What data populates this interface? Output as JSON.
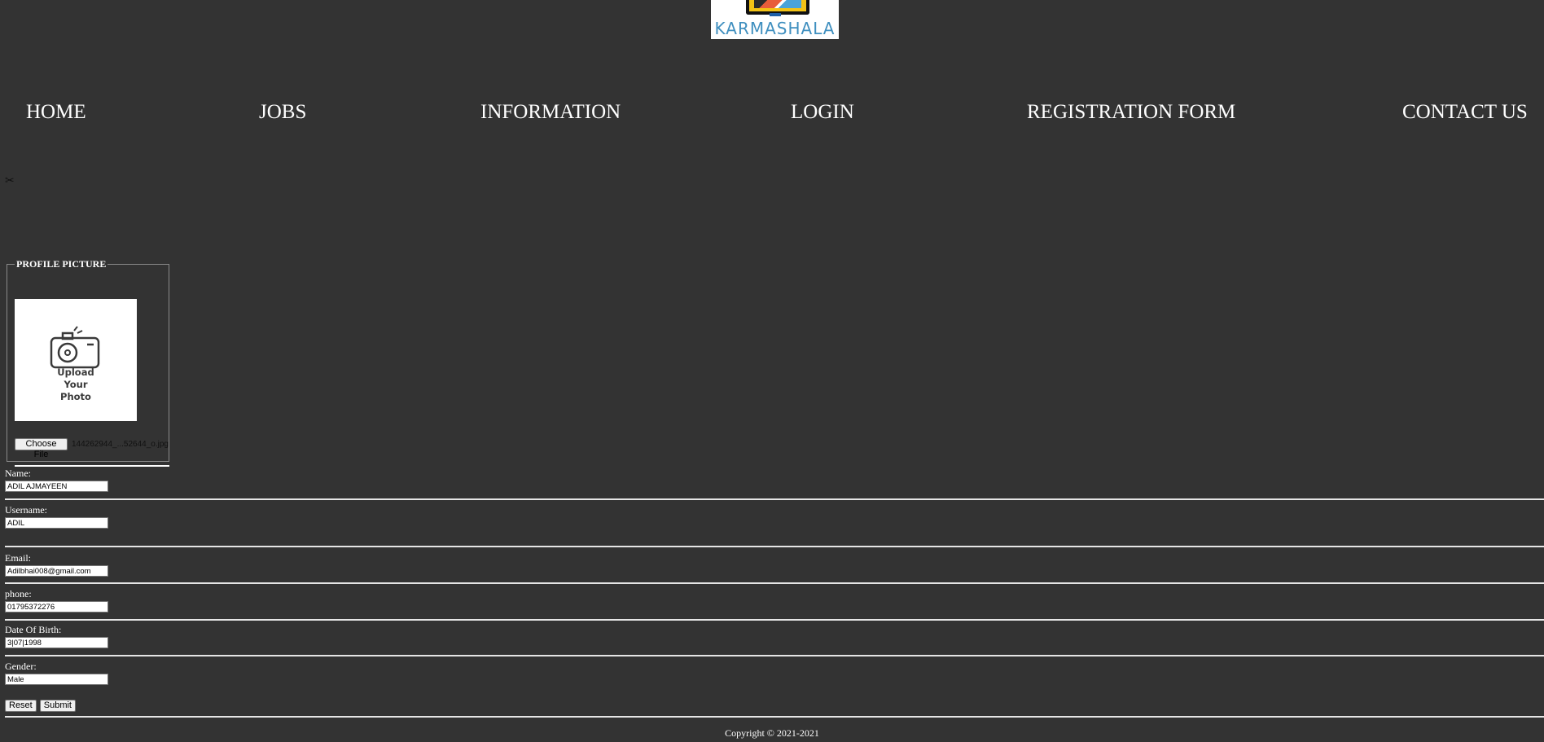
{
  "logo": {
    "wordmark": "KARMASHALA"
  },
  "nav": {
    "items": [
      "HOME",
      "JOBS",
      "INFORMATION",
      "LOGIN",
      "REGISTRATION FORM",
      "CONTACT US"
    ]
  },
  "broken_image_icon": "broken-image-icon",
  "profile": {
    "legend": "PROFILE PICTURE",
    "upload_text": "Upload\nYour\nPhoto",
    "choose_file_label": "Choose File",
    "file_name": "144262944_...52644_o.jpg"
  },
  "form": {
    "name": {
      "label": "Name:",
      "value": "ADIL AJMAYEEN"
    },
    "username": {
      "label": "Username:",
      "value": "ADIL"
    },
    "email": {
      "label": "Email:",
      "value": "Adilbhai008@gmail.com"
    },
    "phone": {
      "label": "phone:",
      "value": "01795372276"
    },
    "dob": {
      "label": "Date Of Birth:",
      "value": "3|07|1998"
    },
    "gender": {
      "label": "Gender:",
      "value": "Male"
    },
    "reset_label": "Reset",
    "submit_label": "Submit"
  },
  "footer": {
    "copyright": "Copyright © 2021-2021"
  },
  "colors": {
    "background": "#333333",
    "text": "#ffffff",
    "logo_blue": "#3f8fbf",
    "logo_yellow": "#f3c316"
  }
}
